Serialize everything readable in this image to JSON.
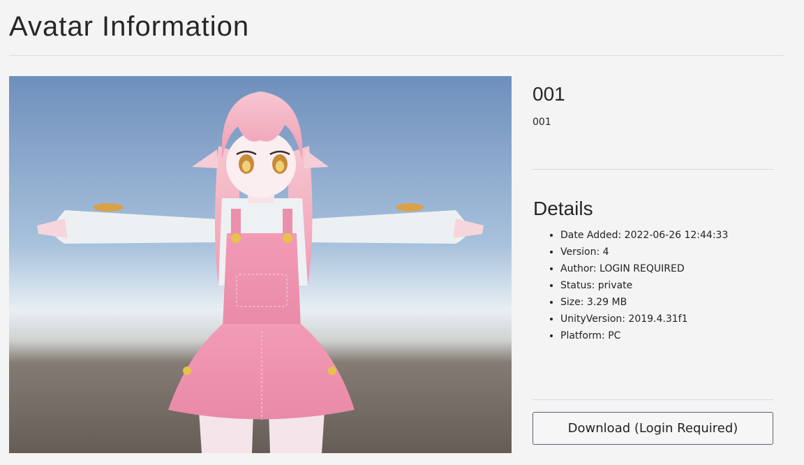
{
  "page": {
    "title": "Avatar Information"
  },
  "avatar": {
    "name": "001",
    "description": "001",
    "image_alt": "avatar-preview"
  },
  "details": {
    "heading": "Details",
    "items": [
      {
        "label": "Date Added: 2022-06-26 12:44:33"
      },
      {
        "label": "Version: 4"
      },
      {
        "label": "Author: LOGIN REQUIRED"
      },
      {
        "label": "Status: private"
      },
      {
        "label": "Size: 3.29 MB"
      },
      {
        "label": "UnityVersion: 2019.4.31f1"
      },
      {
        "label": "Platform: PC"
      }
    ]
  },
  "actions": {
    "download_label": "Download (Login Required)"
  },
  "colors": {
    "sky_top": "#7393bd",
    "sky_horizon": "#e4edf4",
    "ground": "#6a6058",
    "hair": "#f2b2c0",
    "overalls": "#ec90ad",
    "shirt": "#eceff2"
  }
}
